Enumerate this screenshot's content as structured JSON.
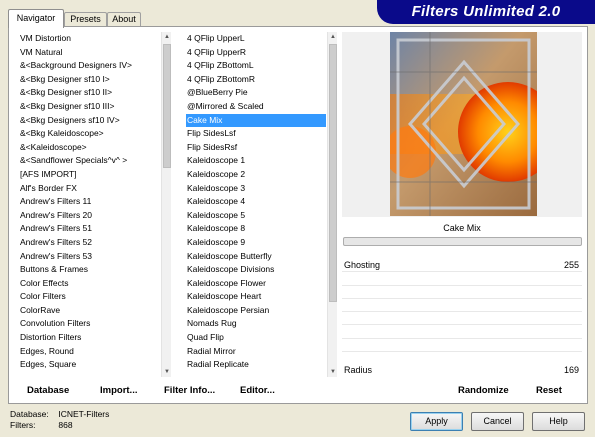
{
  "tabs": [
    {
      "label": "Navigator"
    },
    {
      "label": "Presets"
    },
    {
      "label": "About"
    }
  ],
  "banner": {
    "title": "Filters Unlimited 2.0"
  },
  "categories": [
    "VM Distortion",
    "VM Natural",
    "&<Background Designers IV>",
    "&<Bkg Designer sf10 I>",
    "&<Bkg Designer sf10 II>",
    "&<Bkg Designer sf10 III>",
    "&<Bkg Designers sf10 IV>",
    "&<Bkg Kaleidoscope>",
    "&<Kaleidoscope>",
    "&<Sandflower Specials^v^ >",
    "[AFS IMPORT]",
    "Alf's Border FX",
    "Andrew's Filters 11",
    "Andrew's Filters 20",
    "Andrew's Filters 51",
    "Andrew's Filters 52",
    "Andrew's Filters 53",
    "Buttons & Frames",
    "Color Effects",
    "Color Filters",
    "ColorRave",
    "Convolution Filters",
    "Distortion Filters",
    "Edges, Round",
    "Edges, Square"
  ],
  "filters": [
    "4 QFlip UpperL",
    "4 QFlip UpperR",
    "4 QFlip ZBottomL",
    "4 QFlip ZBottomR",
    "@BlueBerry Pie",
    "@Mirrored & Scaled",
    "Cake Mix",
    "Flip SidesLsf",
    "Flip SidesRsf",
    "Kaleidoscope 1",
    "Kaleidoscope 2",
    "Kaleidoscope 3",
    "Kaleidoscope 4",
    "Kaleidoscope 5",
    "Kaleidoscope 8",
    "Kaleidoscope 9",
    "Kaleidoscope Butterfly",
    "Kaleidoscope Divisions",
    "Kaleidoscope Flower",
    "Kaleidoscope Heart",
    "Kaleidoscope Persian",
    "Nomads Rug",
    "Quad Flip",
    "Radial Mirror",
    "Radial Replicate"
  ],
  "selected_filter": "Cake Mix",
  "params": {
    "ghosting_label": "Ghosting",
    "ghosting_value": "255",
    "radius_label": "Radius",
    "radius_value": "169"
  },
  "toolbar": {
    "database": "Database",
    "import": "Import...",
    "filter_info": "Filter Info...",
    "editor": "Editor...",
    "randomize": "Randomize",
    "reset": "Reset"
  },
  "footer": {
    "database_label": "Database:",
    "database_value": "ICNET-Filters",
    "filters_label": "Filters:",
    "filters_value": "868"
  },
  "buttons": {
    "apply": "Apply",
    "cancel": "Cancel",
    "help": "Help"
  },
  "colors": {
    "banner": "#0a0a8a",
    "selection": "#3399ff"
  }
}
